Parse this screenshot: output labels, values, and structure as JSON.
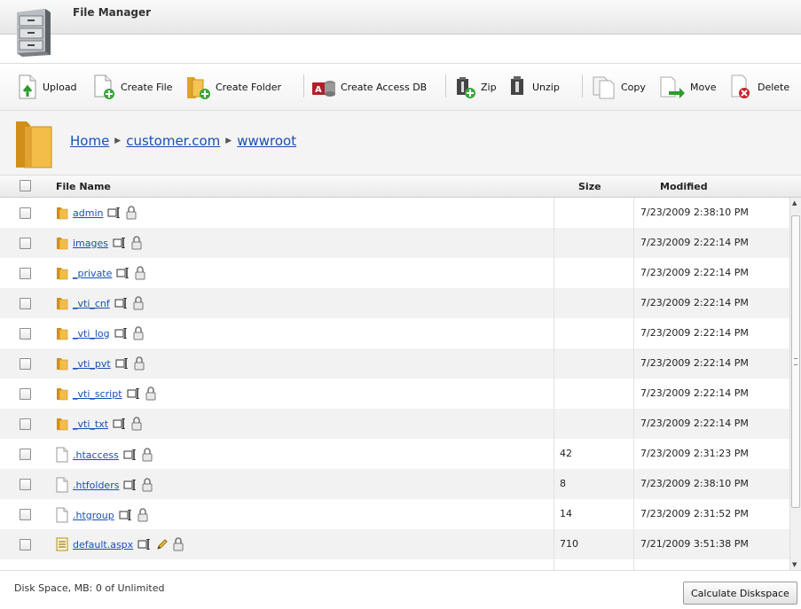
{
  "header": {
    "title": "File Manager"
  },
  "toolbar": {
    "upload": "Upload",
    "create_file": "Create File",
    "create_folder": "Create Folder",
    "create_access_db": "Create Access DB",
    "zip": "Zip",
    "unzip": "Unzip",
    "copy": "Copy",
    "move": "Move",
    "delete": "Delete"
  },
  "breadcrumb": {
    "items": [
      "Home",
      "customer.com",
      "wwwroot"
    ]
  },
  "table": {
    "headers": {
      "name": "File Name",
      "size": "Size",
      "modified": "Modified"
    },
    "rows": [
      {
        "name": "admin",
        "type": "folder",
        "size": "",
        "modified": "7/23/2009 2:38:10 PM"
      },
      {
        "name": "images",
        "type": "folder",
        "size": "",
        "modified": "7/23/2009 2:22:14 PM"
      },
      {
        "name": "_private",
        "type": "folder",
        "size": "",
        "modified": "7/23/2009 2:22:14 PM"
      },
      {
        "name": "_vti_cnf",
        "type": "folder",
        "size": "",
        "modified": "7/23/2009 2:22:14 PM"
      },
      {
        "name": "_vti_log",
        "type": "folder",
        "size": "",
        "modified": "7/23/2009 2:22:14 PM"
      },
      {
        "name": "_vti_pvt",
        "type": "folder",
        "size": "",
        "modified": "7/23/2009 2:22:14 PM"
      },
      {
        "name": "_vti_script",
        "type": "folder",
        "size": "",
        "modified": "7/23/2009 2:22:14 PM"
      },
      {
        "name": "_vti_txt",
        "type": "folder",
        "size": "",
        "modified": "7/23/2009 2:22:14 PM"
      },
      {
        "name": ".htaccess",
        "type": "file",
        "size": "42",
        "modified": "7/23/2009 2:31:23 PM"
      },
      {
        "name": ".htfolders",
        "type": "file",
        "size": "8",
        "modified": "7/23/2009 2:38:10 PM"
      },
      {
        "name": ".htgroup",
        "type": "file",
        "size": "14",
        "modified": "7/23/2009 2:31:52 PM"
      },
      {
        "name": "default.aspx",
        "type": "aspx",
        "size": "710",
        "modified": "7/21/2009 3:51:38 PM"
      }
    ]
  },
  "footer": {
    "disk_space": "Disk Space, MB: 0 of Unlimited",
    "calc_button": "Calculate Diskspace"
  }
}
